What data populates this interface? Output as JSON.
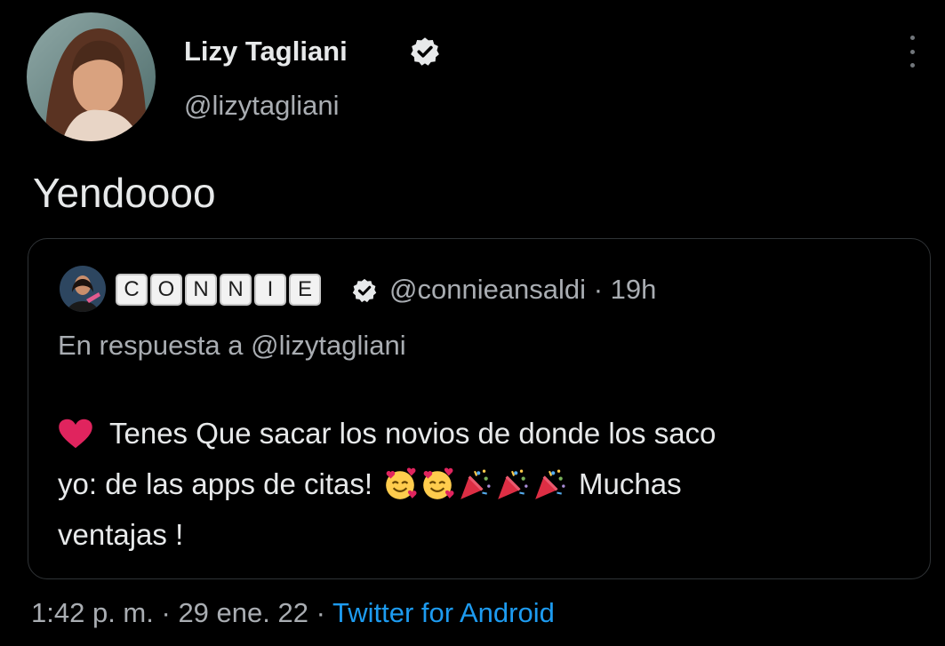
{
  "author": {
    "name": "Lizy Tagliani",
    "handle": "@lizytagliani",
    "verified": true,
    "avatar_icon": "profile-photo"
  },
  "tweet": {
    "text": "Yendoooo"
  },
  "quoted_tweet": {
    "name_tiles": [
      "C",
      "O",
      "N",
      "N",
      "I",
      "E"
    ],
    "verified": true,
    "handle": "@connieansaldi",
    "separator": "·",
    "time": "19h",
    "reply_to": "En respuesta a @lizytagliani",
    "body": {
      "line1": "Tenes Que sacar los novios de donde los saco",
      "line2": "yo: de las apps de citas!",
      "line2_end": "Muchas",
      "line3": "ventajas !"
    },
    "emojis": [
      "heart-icon",
      "smiling-face-with-hearts-icon",
      "smiling-face-with-hearts-icon",
      "party-popper-icon",
      "party-popper-icon",
      "party-popper-icon"
    ]
  },
  "footer": {
    "time": "1:42 p. m.",
    "separator1": "·",
    "date": "29 ene. 22",
    "separator2": "·",
    "source": "Twitter for Android"
  },
  "colors": {
    "background": "#000000",
    "text": "#e7e9ea",
    "secondary": "#a9adb2",
    "link": "#1d9bf0",
    "border": "#2f3336"
  }
}
